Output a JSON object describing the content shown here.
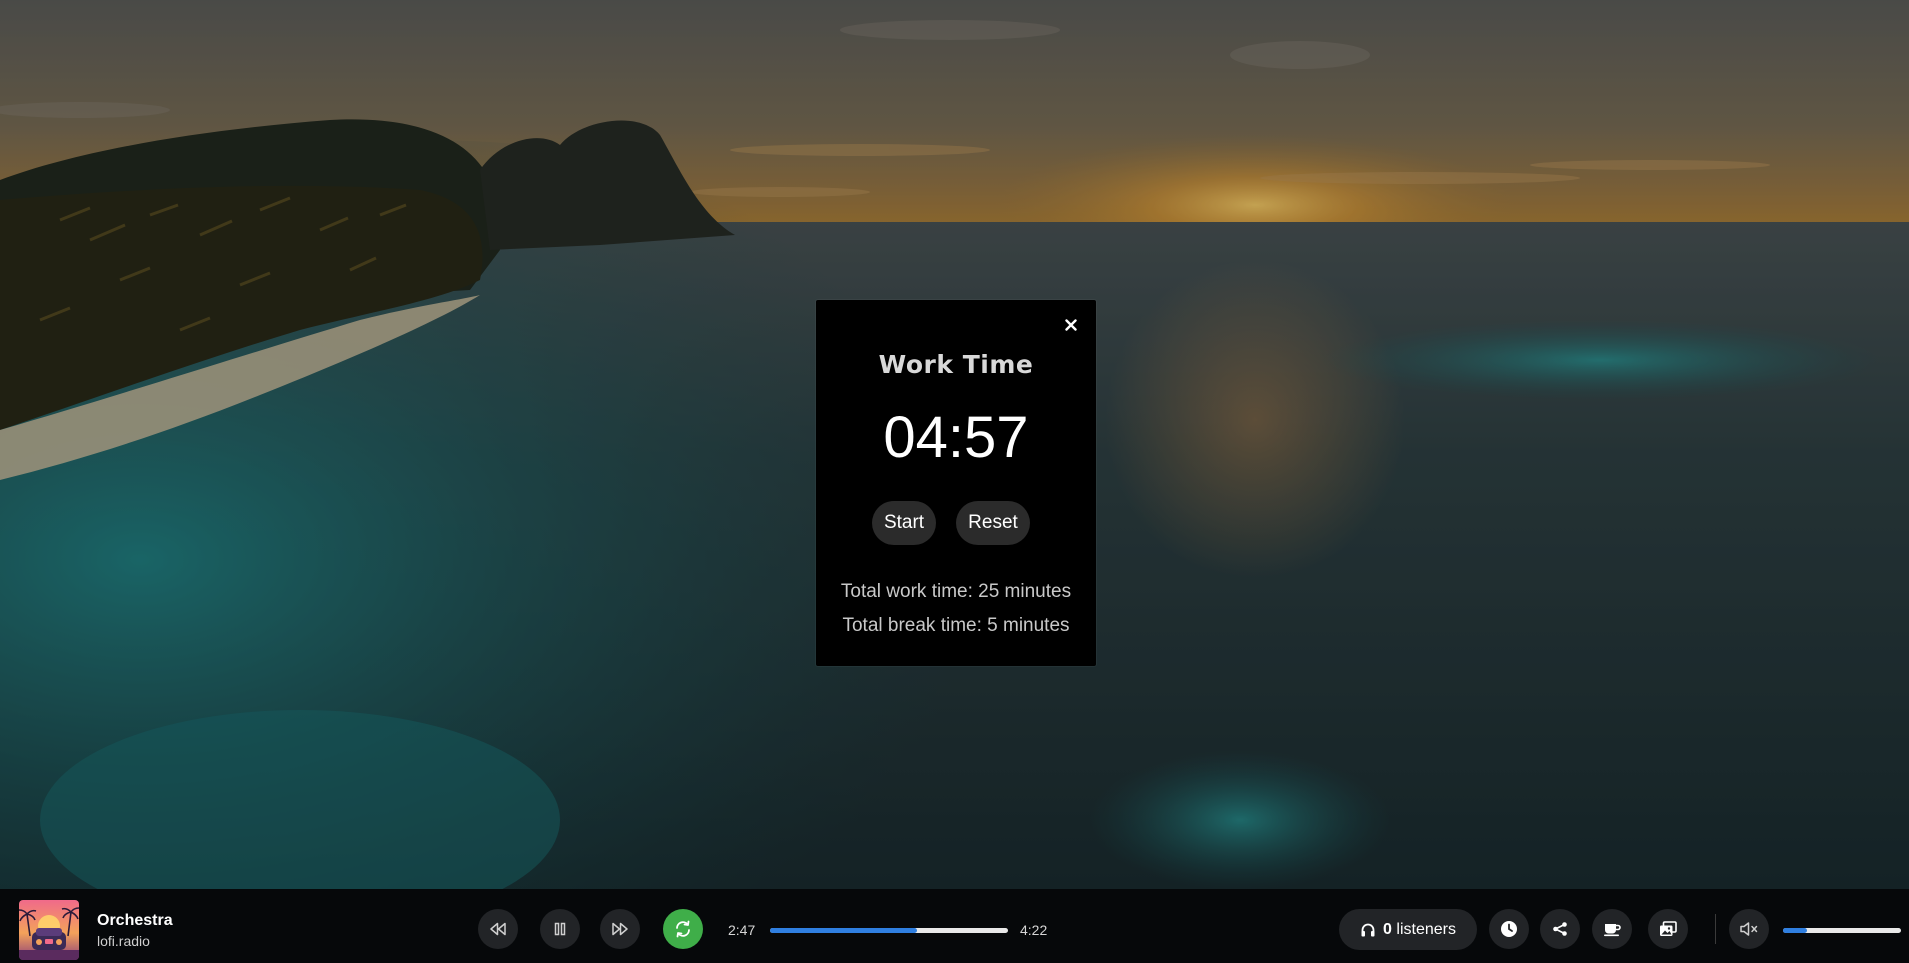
{
  "timer": {
    "title": "Work Time",
    "display": "04:57",
    "start_label": "Start",
    "reset_label": "Reset",
    "total_work": "Total work time: 25 minutes",
    "total_break": "Total break time: 5 minutes",
    "close_label": "×"
  },
  "player": {
    "track_title": "Orchestra",
    "track_artist": "lofi.radio",
    "time_elapsed": "2:47",
    "time_total": "4:22",
    "progress_fraction": 0.617,
    "listeners_count": "0",
    "listeners_label": "listeners",
    "volume_fraction": 0.2,
    "muted": true
  },
  "icons": {
    "rewind": "rewind-icon",
    "pause": "pause-icon",
    "forward": "fast-forward-icon",
    "repeat": "repeat-icon",
    "headphones": "headphones-icon",
    "clock": "clock-icon",
    "share": "share-icon",
    "coffee": "coffee-cup-icon",
    "gallery": "image-gallery-icon",
    "mute": "speaker-muted-icon",
    "close": "close-icon"
  },
  "colors": {
    "accent_blue": "#2f7fe0",
    "repeat_active_green": "#3fae49",
    "modal_bg": "#000000",
    "bar_bg": "#06080a",
    "button_bg": "#222427"
  }
}
